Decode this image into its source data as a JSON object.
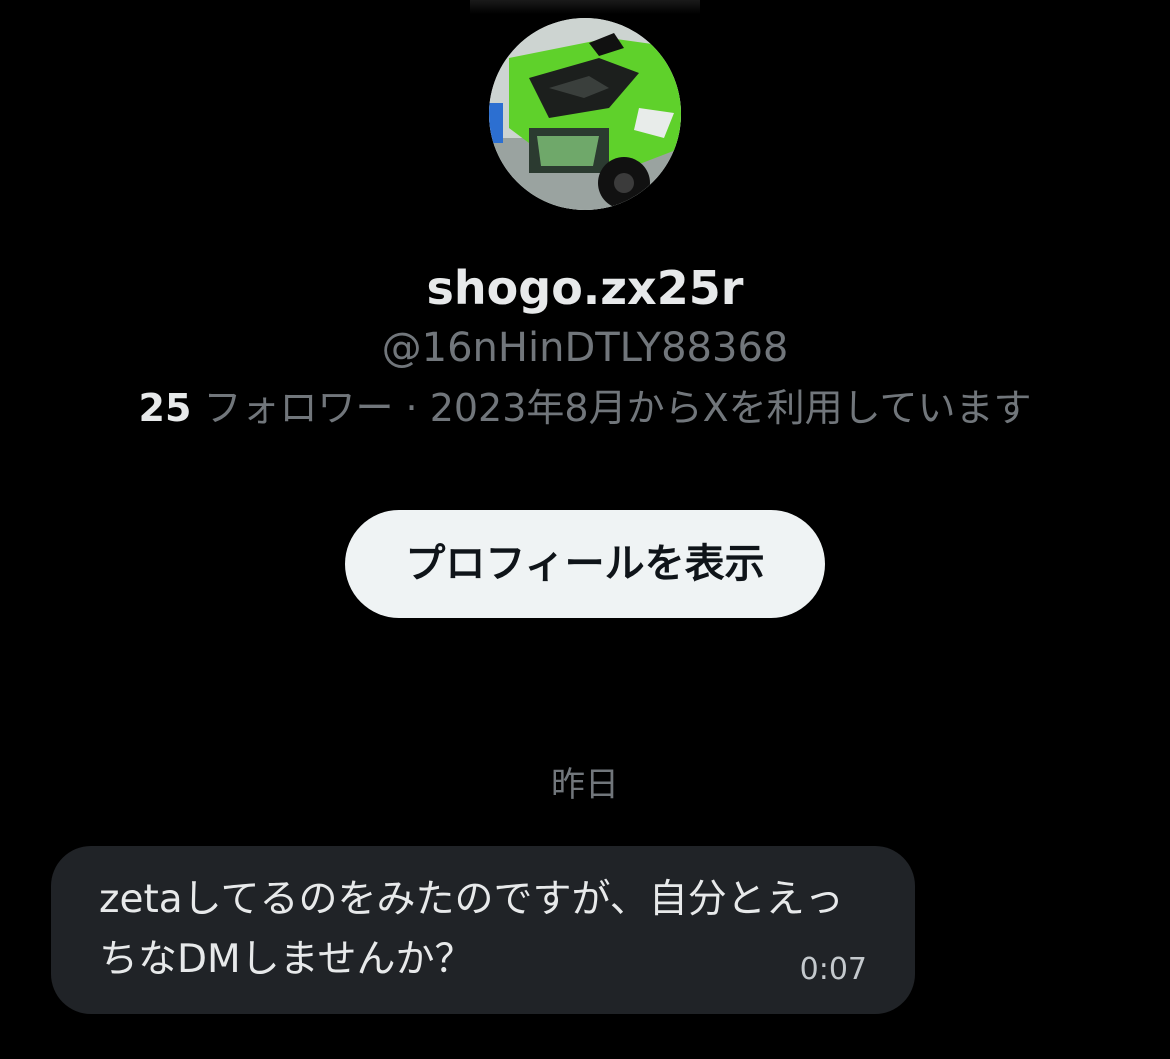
{
  "profile": {
    "display_name": "shogo.zx25r",
    "handle": "@16nHinDTLY88368",
    "follower_count": "25",
    "meta_text": " フォロワー · 2023年8月からXを利用しています",
    "avatar_icon": "green-motorcycle-avatar"
  },
  "actions": {
    "view_profile_label": "プロフィールを表示"
  },
  "conversation": {
    "date_separator": "昨日",
    "messages": [
      {
        "text": "zetaしてるのをみたのですが、自分とえっちなDMしませんか？",
        "time": "0:07"
      }
    ]
  },
  "colors": {
    "background": "#000000",
    "primary_text": "#e7e9ea",
    "secondary_text": "#71767b",
    "button_bg": "#eff3f4",
    "bubble_bg": "#202327",
    "avatar_green": "#5fd12b"
  }
}
